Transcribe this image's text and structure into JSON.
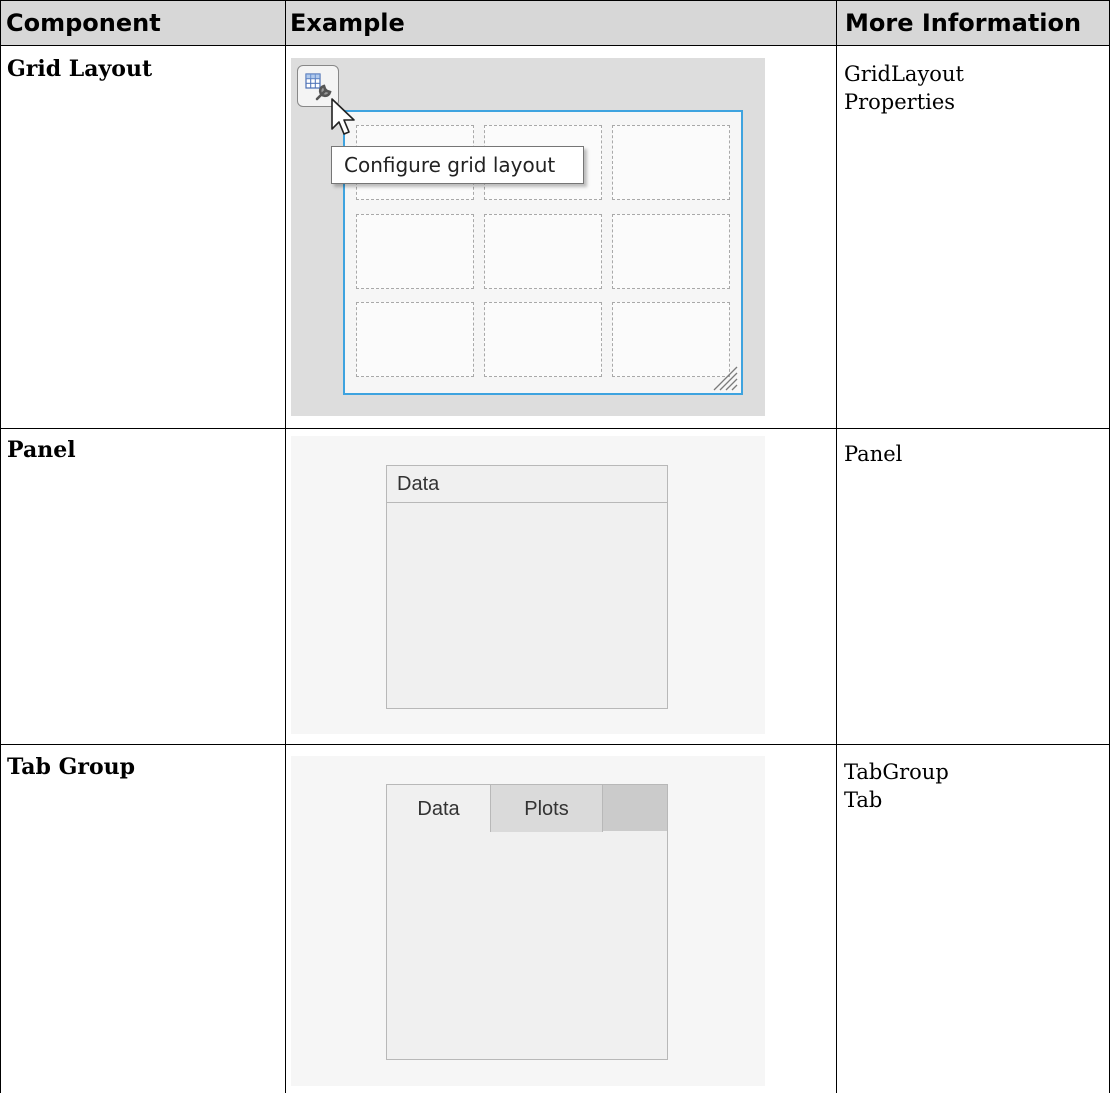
{
  "table": {
    "headers": [
      "Component",
      "Example",
      "More Information"
    ],
    "rows": [
      {
        "component": "Grid Layout",
        "info": [
          "GridLayout",
          "Properties"
        ],
        "example": {
          "tooltip": "Configure grid layout",
          "button_icon": "grid-wrench-icon",
          "grid_cells": 9
        }
      },
      {
        "component": "Panel",
        "info": [
          "Panel"
        ],
        "example": {
          "panel_title": "Data"
        }
      },
      {
        "component": "Tab Group",
        "info": [
          "TabGroup",
          "Tab"
        ],
        "example": {
          "tabs": [
            "Data",
            "Plots"
          ],
          "selected_tab": "Data"
        }
      }
    ]
  },
  "colors": {
    "header_bg": "#d7d7d7",
    "grid_selection": "#3ea3df",
    "grid_bg": "#dddddd"
  }
}
